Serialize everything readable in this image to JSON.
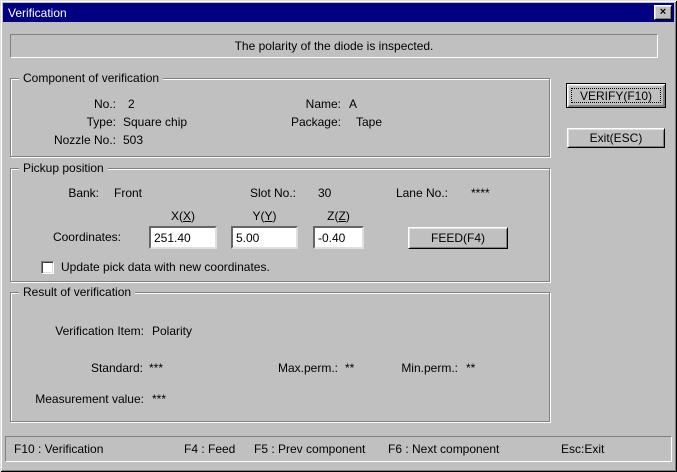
{
  "window": {
    "title": "Verification",
    "close_glyph": "×"
  },
  "message": "The polarity of the diode is inspected.",
  "component": {
    "title": "Component of verification",
    "no_label": "No.:",
    "no_value": "2",
    "name_label": "Name:",
    "name_value": "A",
    "type_label": "Type:",
    "type_value": "Square chip",
    "package_label": "Package:",
    "package_value": "Tape",
    "nozzle_label": "Nozzle No.:",
    "nozzle_value": "503"
  },
  "actions": {
    "verify_label": "VERIFY(F10)",
    "exit_label": "Exit(ESC)"
  },
  "pickup": {
    "title": "Pickup position",
    "bank_label": "Bank:",
    "bank_value": "Front",
    "slot_label": "Slot No.:",
    "slot_value": "30",
    "lane_label": "Lane No.:",
    "lane_value": "****",
    "headers": {
      "x": {
        "pre": "X(",
        "key": "X",
        "post": ")"
      },
      "y": {
        "pre": "Y(",
        "key": "Y",
        "post": ")"
      },
      "z": {
        "pre": "Z(",
        "key": "Z",
        "post": ")"
      }
    },
    "coordinates_label": "Coordinates:",
    "coords": {
      "x": "251.40",
      "y": "5.00",
      "z": "-0.40"
    },
    "feed_label": "FEED(F4)",
    "update_checkbox_label": "Update pick data with new coordinates.",
    "update_checkbox_checked": false
  },
  "result": {
    "title": "Result of verification",
    "item_label": "Verification Item:",
    "item_value": "Polarity",
    "standard_label": "Standard:",
    "standard_value": "***",
    "max_label": "Max.perm.:",
    "max_value": "**",
    "min_label": "Min.perm.:",
    "min_value": "**",
    "measurement_label": "Measurement value:",
    "measurement_value": "***"
  },
  "statusbar": {
    "items": [
      "F10 : Verification",
      "F4 : Feed",
      "F5 : Prev component",
      "F6 : Next component",
      "Esc:Exit"
    ]
  },
  "colors": {
    "titlebar": "#000080",
    "window_bg": "#c0c0c0"
  }
}
